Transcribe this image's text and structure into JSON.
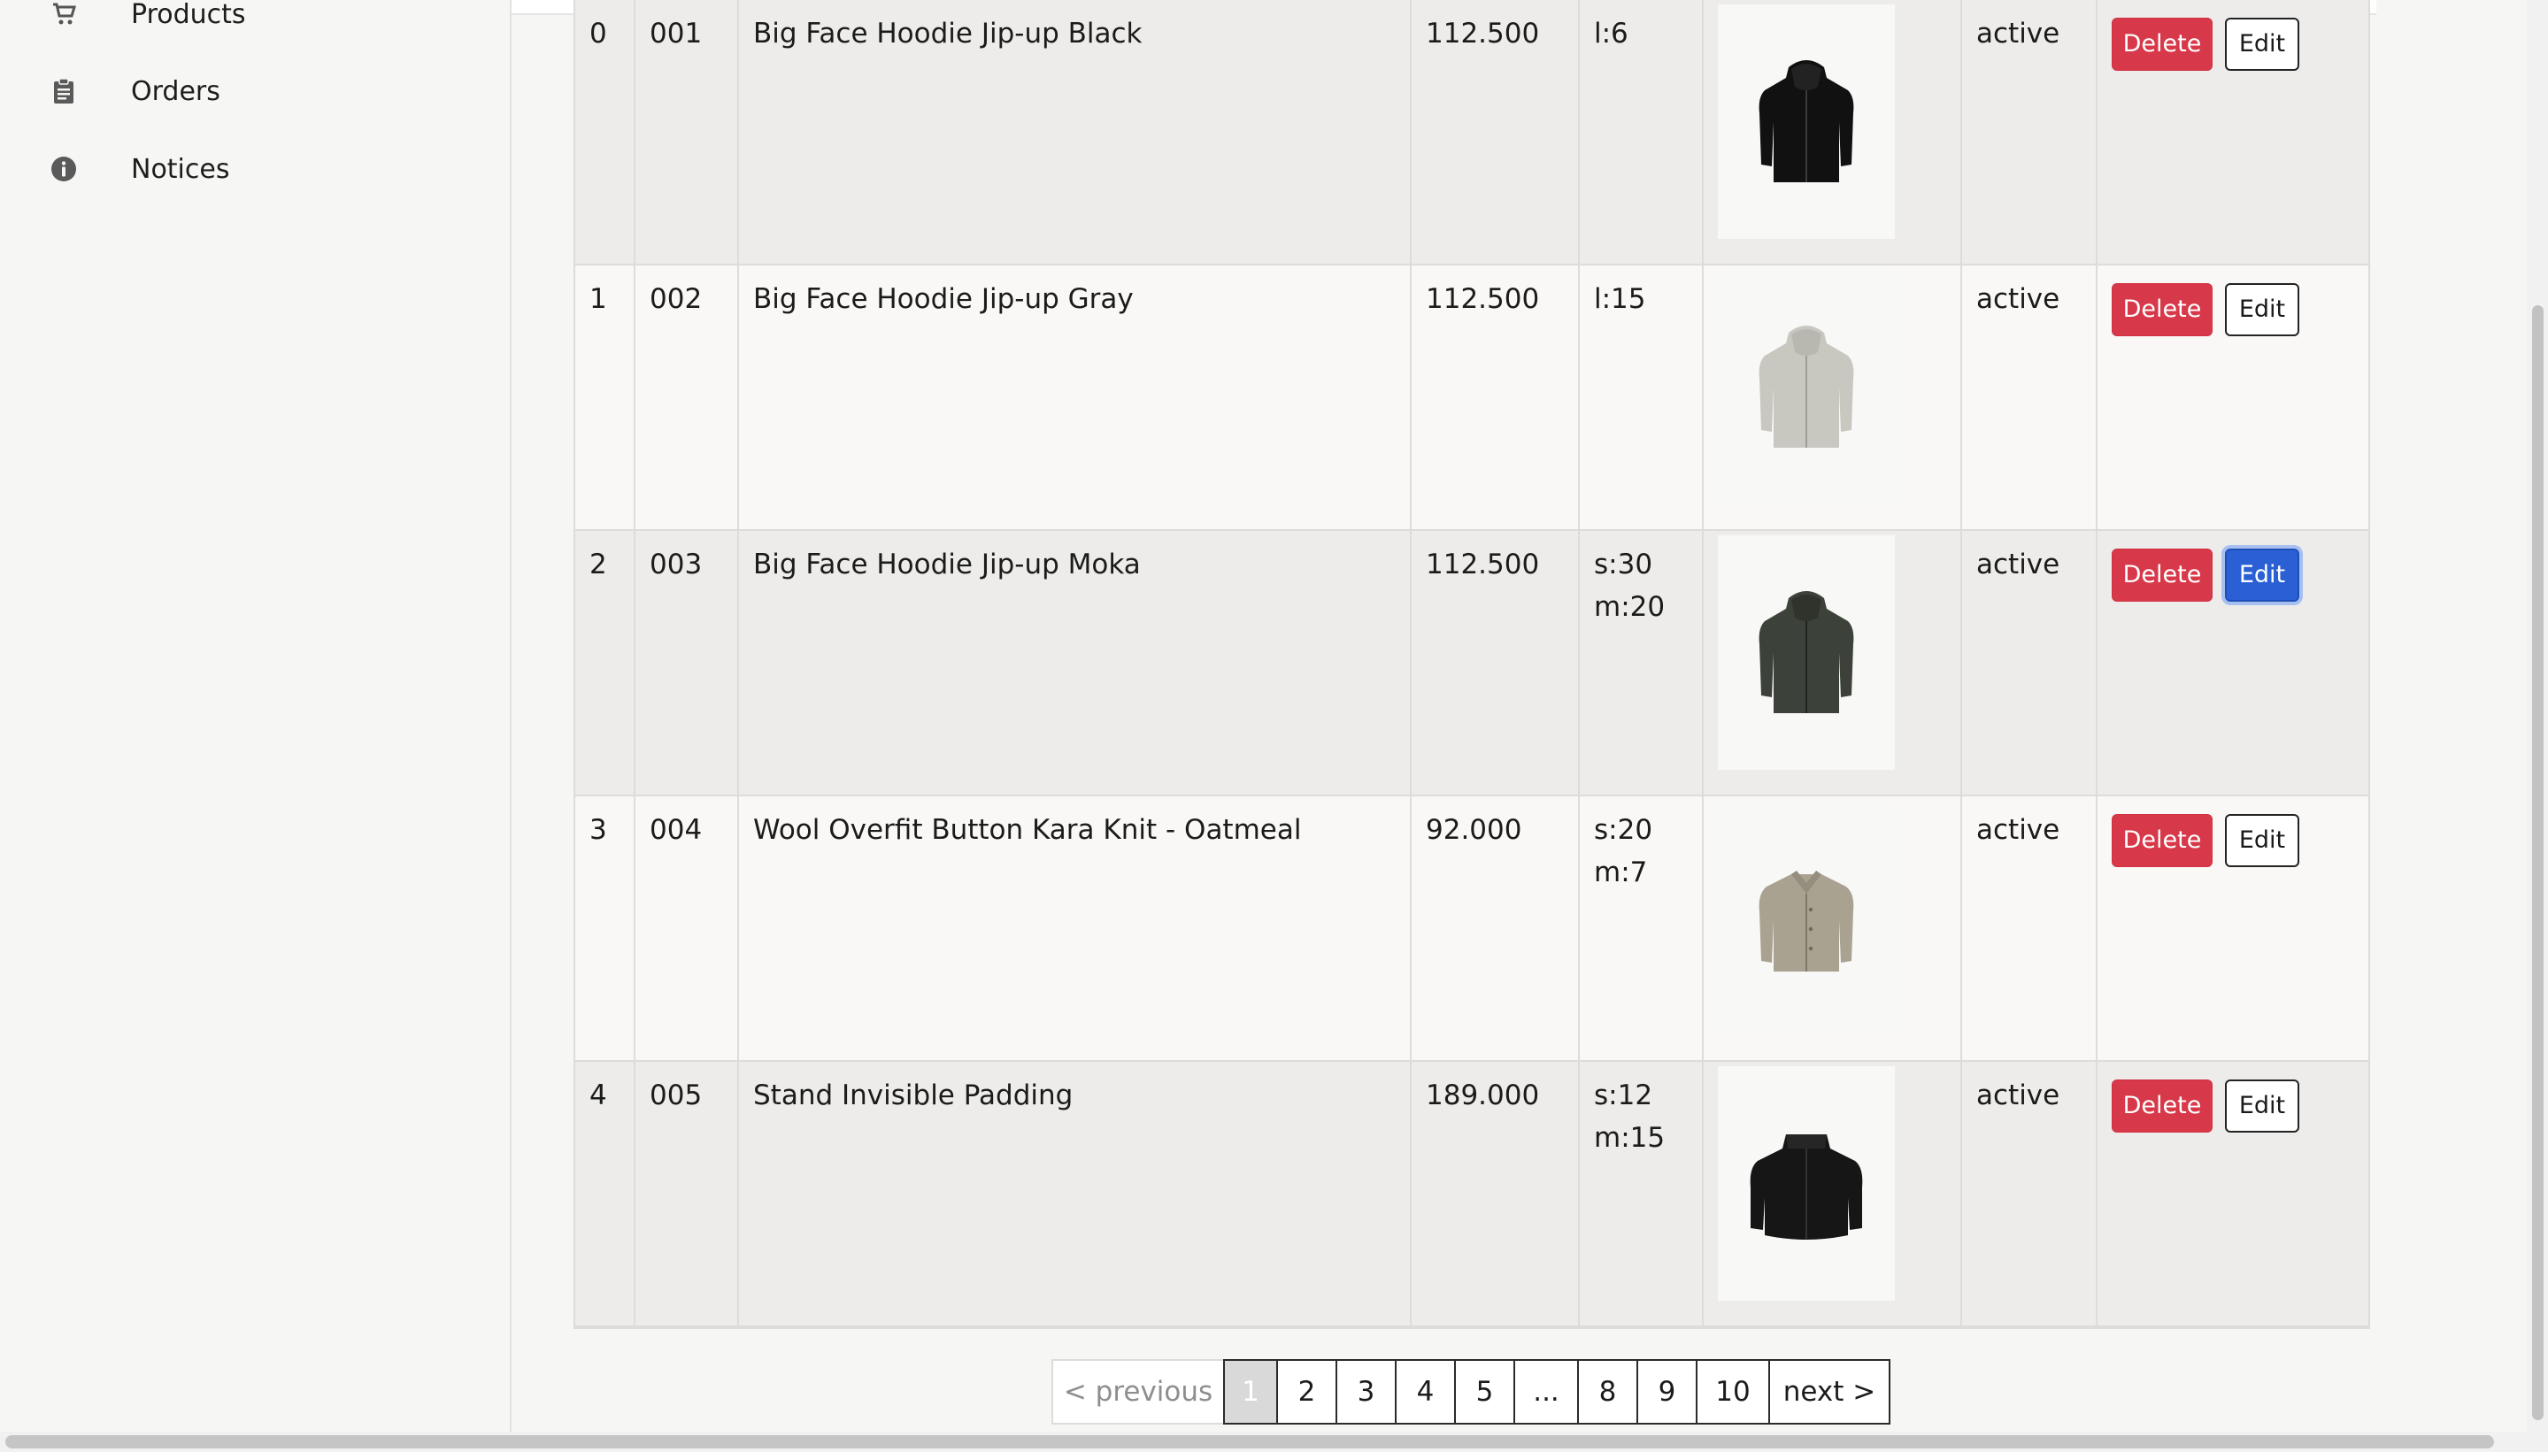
{
  "sidebar": {
    "items": [
      {
        "label": "Products",
        "icon": "cart-icon"
      },
      {
        "label": "Orders",
        "icon": "clipboard-icon"
      },
      {
        "label": "Notices",
        "icon": "info-icon"
      }
    ]
  },
  "table": {
    "rows": [
      {
        "index": "0",
        "code": "001",
        "name": "Big Face Hoodie Jip-up Black",
        "price": "112.500",
        "stock": "l:6",
        "image": "black-zip-hoodie",
        "status": "active",
        "delete_label": "Delete",
        "edit_label": "Edit"
      },
      {
        "index": "1",
        "code": "002",
        "name": "Big Face Hoodie Jip-up Gray",
        "price": "112.500",
        "stock": "l:15",
        "image": "gray-zip-hoodie",
        "status": "active",
        "delete_label": "Delete",
        "edit_label": "Edit"
      },
      {
        "index": "2",
        "code": "003",
        "name": "Big Face Hoodie Jip-up Moka",
        "price": "112.500",
        "stock": "s:30\nm:20",
        "image": "moka-zip-hoodie",
        "status": "active",
        "delete_label": "Delete",
        "edit_label": "Edit"
      },
      {
        "index": "3",
        "code": "004",
        "name": "Wool Overfit Button Kara Knit - Oatmeal",
        "price": "92.000",
        "stock": "s:20\nm:7",
        "image": "oatmeal-knit",
        "status": "active",
        "delete_label": "Delete",
        "edit_label": "Edit"
      },
      {
        "index": "4",
        "code": "005",
        "name": "Stand Invisible Padding",
        "price": "189.000",
        "stock": "s:12\nm:15",
        "image": "black-padding-jacket",
        "status": "active",
        "delete_label": "Delete",
        "edit_label": "Edit"
      }
    ]
  },
  "pagination": {
    "previous_label": "< previous",
    "pages": [
      "1",
      "2",
      "3",
      "4",
      "5",
      "...",
      "8",
      "9",
      "10"
    ],
    "current": "1",
    "next_label": "next >"
  },
  "colors": {
    "delete": "#d7394a",
    "edit_active": "#2a60d4",
    "row_odd": "#edecea",
    "row_even": "#f9f8f6"
  }
}
